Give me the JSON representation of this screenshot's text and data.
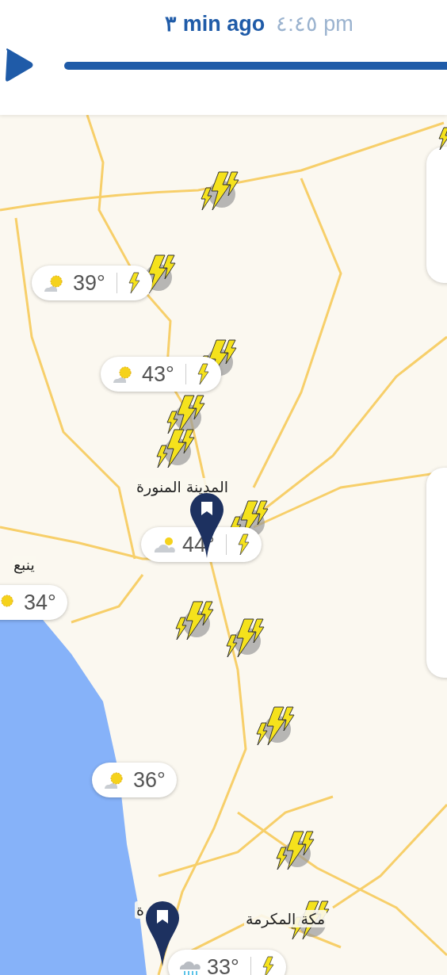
{
  "header": {
    "relative_time": "٣ min ago",
    "clock": "٤:٤٥ pm"
  },
  "map": {
    "places": [
      {
        "name": "المدينة المنورة"
      },
      {
        "name": "ينبع"
      },
      {
        "name": "مكة المكرمة"
      },
      {
        "name": "ة"
      }
    ],
    "weather_chips": [
      {
        "temperature": "39°",
        "kind": "sun-cloud",
        "lightning": true
      },
      {
        "temperature": "43°",
        "kind": "sun-cloud",
        "lightning": true
      },
      {
        "temperature": "44°",
        "kind": "cloud-sun",
        "lightning": true
      },
      {
        "temperature": "34°",
        "kind": "sun",
        "lightning": false
      },
      {
        "temperature": "36°",
        "kind": "sun-cloud",
        "lightning": false
      },
      {
        "temperature": "33°",
        "kind": "rain",
        "lightning": true
      }
    ]
  }
}
